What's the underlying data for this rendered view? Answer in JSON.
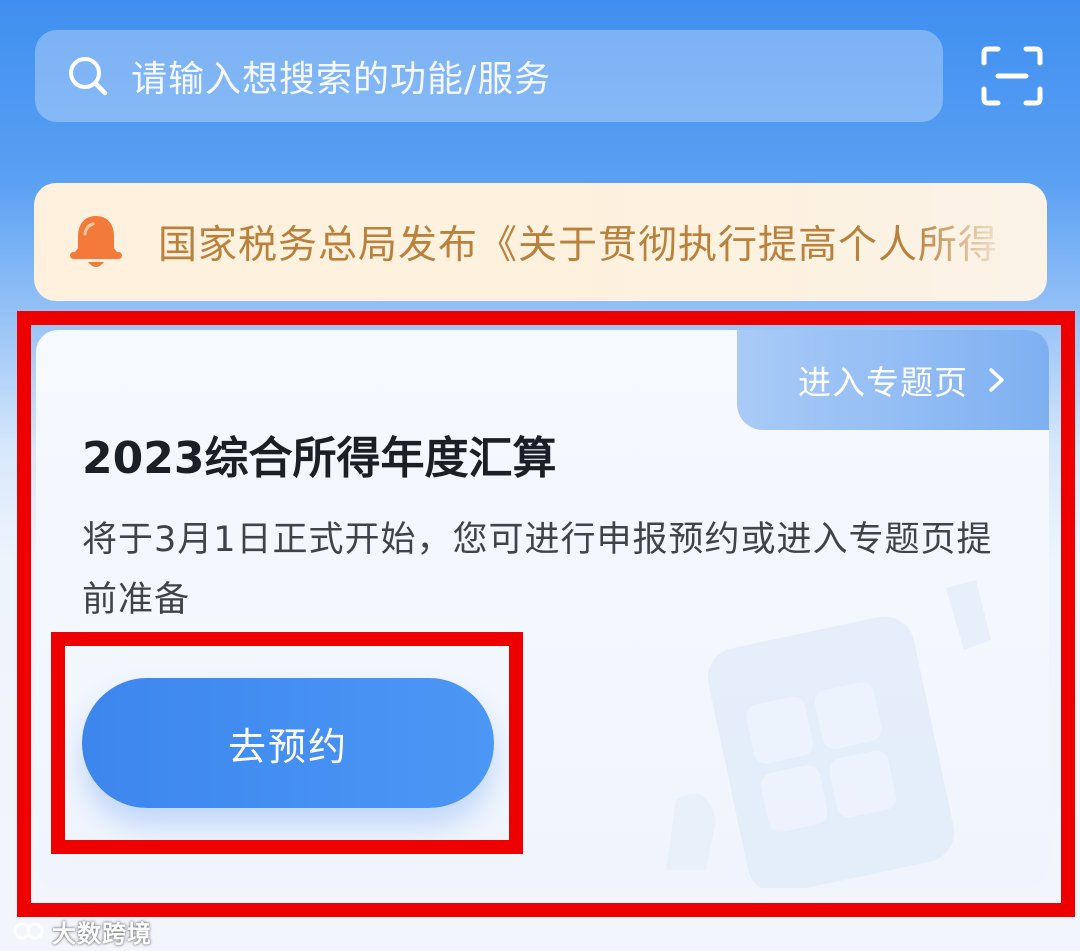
{
  "search": {
    "placeholder": "请输入想搜索的功能/服务",
    "icon": "search-icon",
    "scan_icon": "scan-icon"
  },
  "notice": {
    "icon": "bell-icon",
    "text": "国家税务总局发布《关于贯彻执行提高个人所得"
  },
  "card": {
    "topic_link": "进入专题页",
    "title": "2023综合所得年度汇算",
    "description": "将于3月1日正式开始，您可进行申报预约或进入专题页提前准备",
    "button_label": "去预约"
  },
  "watermark": {
    "text": "大数跨境"
  },
  "colors": {
    "primary_blue": "#3c86ee",
    "notice_text": "#b9813c",
    "notice_bg": "#fff1dd",
    "bell_orange": "#f47a3a",
    "annotation_red": "#ee0000"
  }
}
